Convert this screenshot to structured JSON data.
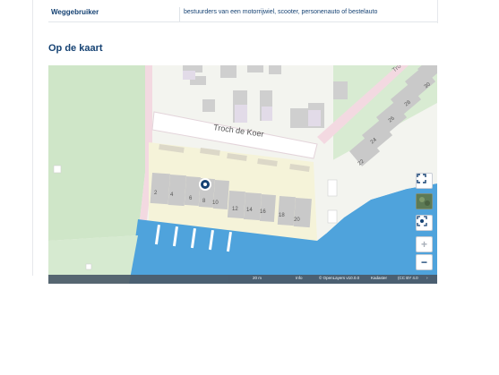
{
  "info_row": {
    "label": "Weggebruiker",
    "value": "bestuurders van een motorrijwiel, scooter, personenauto of bestelauto"
  },
  "section_title": "Op de kaart",
  "map": {
    "street_name": "Troch de Koer",
    "street_name_corner": "Tro",
    "house_numbers": [
      "2",
      "4",
      "6",
      "8",
      "10",
      "12",
      "14",
      "16",
      "18",
      "20",
      "22",
      "24",
      "26",
      "28",
      "30"
    ],
    "controls": {
      "fullscreen_icon": "fullscreen-icon",
      "layers_icon": "aerial-layer-icon",
      "locate_icon": "locate-icon",
      "zoom_in": "+",
      "zoom_out": "−"
    },
    "attribution": {
      "scale": "20 m",
      "info": "Info",
      "openlayers": "© OpenLayers v10.0.0",
      "kadaster": "Kadaster",
      "license": "(CC BY 4.0",
      "collapse": "›"
    },
    "colors": {
      "water": "#4fa3dc",
      "green": "#cfe6c8",
      "building": "#c9c9c9",
      "highlight_area": "#f5f3d9",
      "marker": "#154273"
    }
  }
}
